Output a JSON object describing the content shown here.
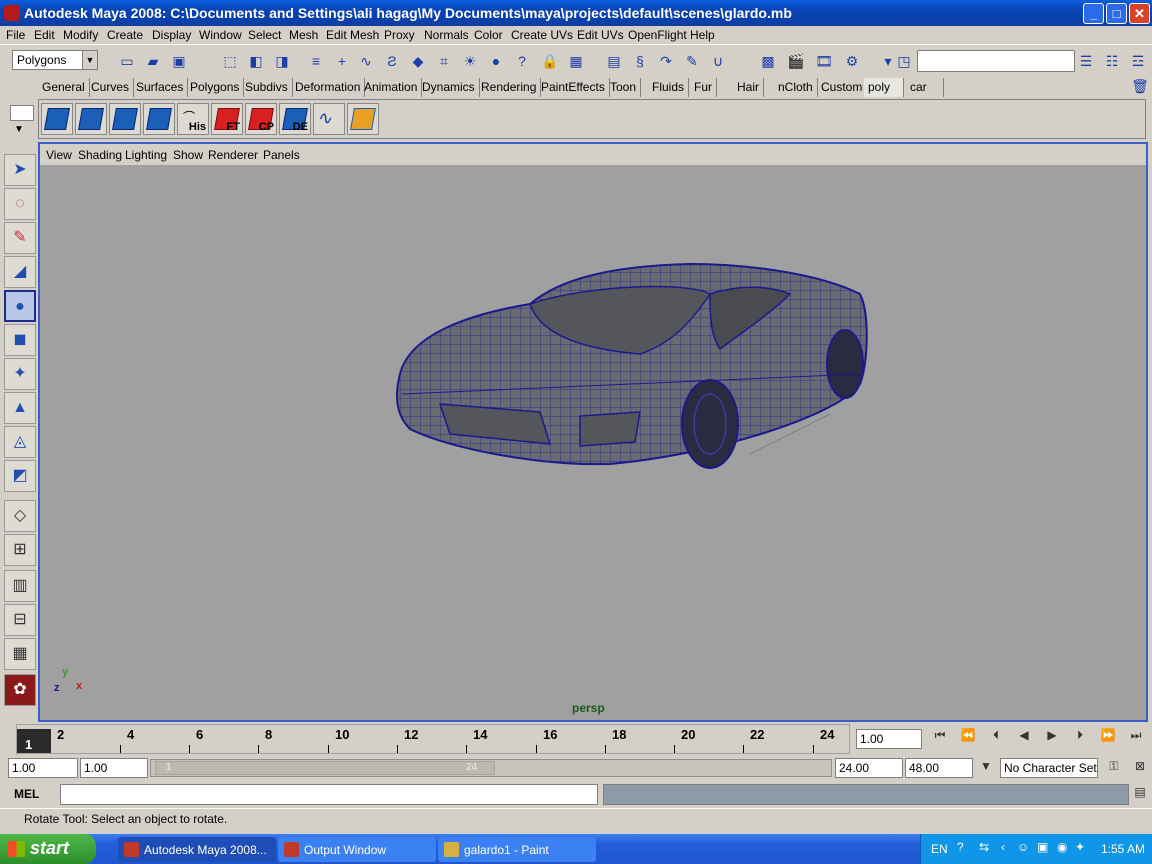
{
  "window": {
    "title": "Autodesk Maya 2008: C:\\Documents and Settings\\ali hagag\\My Documents\\maya\\projects\\default\\scenes\\glardo.mb",
    "min": "_",
    "max": "□",
    "close": "✕"
  },
  "menu": [
    "File",
    "Edit",
    "Modify",
    "Create",
    "Display",
    "Window",
    "Select",
    "Mesh",
    "Edit Mesh",
    "Proxy",
    "Normals",
    "Color",
    "Create UVs",
    "Edit UVs",
    "OpenFlight",
    "Help"
  ],
  "status_line": {
    "menu_set": "Polygons"
  },
  "shelf_tabs": [
    "General",
    "Curves",
    "Surfaces",
    "Polygons",
    "Subdivs",
    "Deformation",
    "Animation",
    "Dynamics",
    "Rendering",
    "PaintEffects",
    "Toon",
    "Fluids",
    "Fur",
    "Hair",
    "nCloth",
    "Custom",
    "poly",
    "car"
  ],
  "shelf_active": "poly",
  "shelf_buttons": [
    "",
    "",
    "",
    "",
    "His",
    "FT",
    "CP",
    "DE",
    "",
    ""
  ],
  "viewport": {
    "menu": [
      "View",
      "Shading",
      "Lighting",
      "Show",
      "Renderer",
      "Panels"
    ],
    "camera": "persp",
    "axis": {
      "y": "y",
      "z": "z",
      "x": "x"
    }
  },
  "timeline": {
    "current_frame": "1",
    "ticks": [
      "2",
      "4",
      "6",
      "8",
      "10",
      "12",
      "14",
      "16",
      "18",
      "20",
      "22",
      "24"
    ],
    "current_time_field": "1.00"
  },
  "range": {
    "start": "1.00",
    "playback_start": "1.00",
    "slider_start": "1",
    "slider_end": "24",
    "playback_end": "24.00",
    "end": "48.00",
    "character_set": "No Character Set"
  },
  "command_line": {
    "label": "MEL"
  },
  "help_line": "Rotate Tool: Select an object to rotate.",
  "taskbar": {
    "start": "start",
    "tasks": [
      "Autodesk Maya 2008...",
      "Output Window",
      "galardo1 - Paint"
    ],
    "lang": "EN",
    "clock": "1:55 AM"
  },
  "colors": {
    "titlebar": "#0842b5",
    "viewport_bg": "#a0a0a0",
    "wireframe": "#1a1a8c",
    "taskbar": "#245edb"
  }
}
